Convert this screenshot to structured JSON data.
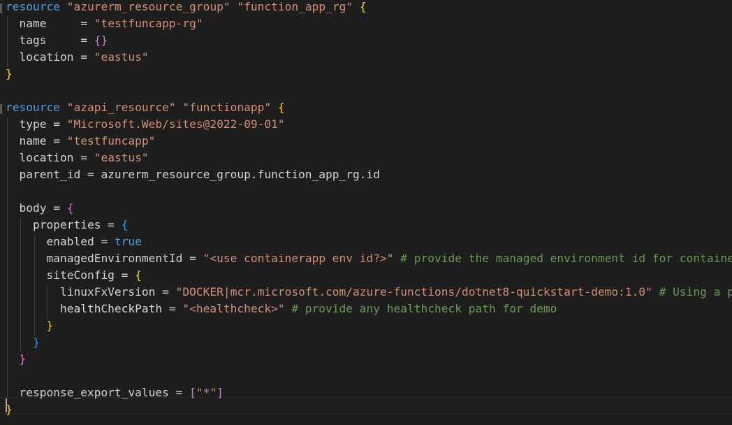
{
  "editor": {
    "lines": [
      {
        "segments": [
          {
            "t": "resource",
            "c": "kw"
          },
          {
            "t": " ",
            "c": "op"
          },
          {
            "t": "\"azurerm_resource_group\"",
            "c": "str"
          },
          {
            "t": " ",
            "c": "op"
          },
          {
            "t": "\"function_app_rg\"",
            "c": "str"
          },
          {
            "t": " ",
            "c": "op"
          },
          {
            "t": "{",
            "c": "b1"
          }
        ]
      },
      {
        "segments": [
          {
            "t": "  name     = ",
            "c": "prop"
          },
          {
            "t": "\"testfuncapp-rg\"",
            "c": "str"
          }
        ]
      },
      {
        "segments": [
          {
            "t": "  tags     = ",
            "c": "prop"
          },
          {
            "t": "{}",
            "c": "b2"
          }
        ]
      },
      {
        "segments": [
          {
            "t": "  location = ",
            "c": "prop"
          },
          {
            "t": "\"eastus\"",
            "c": "str"
          }
        ]
      },
      {
        "segments": [
          {
            "t": "}",
            "c": "b1"
          }
        ]
      },
      {
        "segments": []
      },
      {
        "segments": [
          {
            "t": "resource",
            "c": "kw"
          },
          {
            "t": " ",
            "c": "op"
          },
          {
            "t": "\"azapi_resource\"",
            "c": "str"
          },
          {
            "t": " ",
            "c": "op"
          },
          {
            "t": "\"functionapp\"",
            "c": "str"
          },
          {
            "t": " ",
            "c": "op"
          },
          {
            "t": "{",
            "c": "b1"
          }
        ]
      },
      {
        "segments": [
          {
            "t": "  type = ",
            "c": "prop"
          },
          {
            "t": "\"Microsoft.Web/sites@2022-09-01\"",
            "c": "str"
          }
        ]
      },
      {
        "segments": [
          {
            "t": "  name = ",
            "c": "prop"
          },
          {
            "t": "\"testfuncapp\"",
            "c": "str"
          }
        ]
      },
      {
        "segments": [
          {
            "t": "  location = ",
            "c": "prop"
          },
          {
            "t": "\"eastus\"",
            "c": "str"
          }
        ]
      },
      {
        "segments": [
          {
            "t": "  parent_id = azurerm_resource_group.function_app_rg.id",
            "c": "prop"
          }
        ]
      },
      {
        "segments": []
      },
      {
        "segments": [
          {
            "t": "  body = ",
            "c": "prop"
          },
          {
            "t": "{",
            "c": "b2"
          }
        ]
      },
      {
        "segments": [
          {
            "t": "    properties = ",
            "c": "prop"
          },
          {
            "t": "{",
            "c": "b3"
          }
        ]
      },
      {
        "segments": [
          {
            "t": "      enabled = ",
            "c": "prop"
          },
          {
            "t": "true",
            "c": "kw"
          }
        ]
      },
      {
        "segments": [
          {
            "t": "      managedEnvironmentId = ",
            "c": "prop"
          },
          {
            "t": "\"<use containerapp env id?>\"",
            "c": "str"
          },
          {
            "t": " ",
            "c": "op"
          },
          {
            "t": "# provide the managed environment id for container",
            "c": "cmt"
          }
        ]
      },
      {
        "segments": [
          {
            "t": "      siteConfig = ",
            "c": "prop"
          },
          {
            "t": "{",
            "c": "b1"
          }
        ]
      },
      {
        "segments": [
          {
            "t": "        linuxFxVersion = ",
            "c": "prop"
          },
          {
            "t": "\"DOCKER|mcr.microsoft.com/azure-functions/dotnet8-quickstart-demo:1.0\"",
            "c": "str"
          },
          {
            "t": " ",
            "c": "op"
          },
          {
            "t": "# Using a pu",
            "c": "cmt"
          }
        ]
      },
      {
        "segments": [
          {
            "t": "        healthCheckPath = ",
            "c": "prop"
          },
          {
            "t": "\"<healthcheck>\"",
            "c": "str"
          },
          {
            "t": " ",
            "c": "op"
          },
          {
            "t": "# provide any healthcheck path for demo",
            "c": "cmt"
          }
        ]
      },
      {
        "segments": [
          {
            "t": "      }",
            "c": "b1"
          }
        ]
      },
      {
        "segments": [
          {
            "t": "    }",
            "c": "b3"
          }
        ]
      },
      {
        "segments": [
          {
            "t": "  }",
            "c": "b2"
          }
        ]
      },
      {
        "segments": []
      },
      {
        "segments": [
          {
            "t": "  response_export_values = ",
            "c": "prop"
          },
          {
            "t": "[",
            "c": "b2"
          },
          {
            "t": "\"*\"",
            "c": "str"
          },
          {
            "t": "]",
            "c": "b2"
          }
        ]
      },
      {
        "segments": [
          {
            "t": "}",
            "c": "b1"
          }
        ]
      }
    ],
    "colors": {
      "background": "#1e1e1e",
      "keyword": "#569cd6",
      "string": "#ce9178",
      "comment": "#6a9955",
      "bracket1": "#ffd700",
      "bracket2": "#da70d6",
      "bracket3": "#179fff"
    }
  }
}
